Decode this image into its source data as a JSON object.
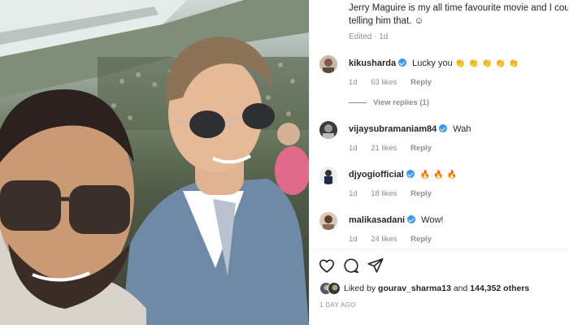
{
  "post": {
    "caption_line1": "Jerry Maguire is my all time favourite movie and I couldn't resist",
    "caption_line2": "telling him that. ☺",
    "edited": "Edited · 1d"
  },
  "comments": [
    {
      "user": "kikusharda",
      "text": "Lucky you",
      "emoji": [
        "👏",
        "👏",
        "👏",
        "👏",
        "👏"
      ],
      "age": "1d",
      "likes": "63 likes",
      "reply": "Reply"
    },
    {
      "user": "vijaysubramaniam84",
      "text": "Wah",
      "emoji": [],
      "age": "1d",
      "likes": "21 likes",
      "reply": "Reply"
    },
    {
      "user": "djyogiofficial",
      "text": "",
      "emoji": [
        "🔥",
        "🔥",
        "🔥"
      ],
      "age": "1d",
      "likes": "18 likes",
      "reply": "Reply"
    },
    {
      "user": "malikasadani",
      "text": "Wow!",
      "emoji": [],
      "age": "1d",
      "likes": "24 likes",
      "reply": "Reply"
    }
  ],
  "view_replies": "View replies (1)",
  "actions": {
    "like": "heart-icon",
    "comment": "comment-icon",
    "share": "share-icon"
  },
  "liked_by": {
    "prefix": "Liked by",
    "user": "gourav_sharma13",
    "conj": "and",
    "others": "144,352 others"
  },
  "timestamp": "1 DAY AGO",
  "colors": {
    "verified": "#3897f0",
    "muted": "#8e8e8e",
    "text": "#262626"
  }
}
